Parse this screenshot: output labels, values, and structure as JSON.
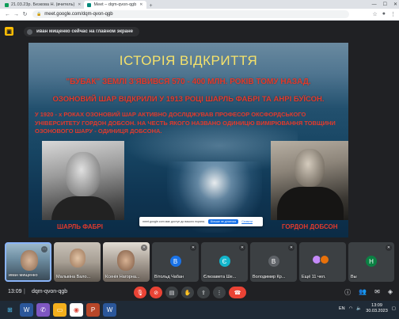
{
  "browser": {
    "tabs": [
      {
        "label": "21.03.23р. Безкова Н. (вчитель)",
        "fav_color": "#0f9d58",
        "active": false
      },
      {
        "label": "Meet – dqm-qvon-qgb",
        "fav_color": "#00897b",
        "active": true
      }
    ],
    "new_tab": "+",
    "window_controls": [
      "—",
      "☐",
      "✕"
    ],
    "url": "meet.google.com/dqm-qvon-qgb"
  },
  "meet": {
    "presenting_text": "иван мищенко сейчас на главном экране",
    "slide": {
      "title": "ІСТОРІЯ ВІДКРИТТЯ",
      "line1": "\"БУБАК\" ЗЕМЛІ З'ЯВИВСЯ 570 - 400 МЛН. РОКІВ ТОМУ НАЗАД.",
      "line2": "ОЗОНОВИЙ ШАР ВІДКРИЛИ У 1913 РОЦІ ШАРЛЬ ФАБРІ ТА АНРІ БУЇСОН.",
      "paragraph": "У 1920 - х РОКАХ ОЗОНОВИЙ ШАР АКТИВНО ДОСЛІДЖУВАВ ПРОФЕСОР ОКСФОРДСЬКОГО УНІВЕРСИТЕТУ ГОРДОН ДОБСОН. НА ЧЕСТЬ ЯКОГО НАЗВАНО ОДИНИЦЮ ВИМІРЮВАННЯ ТОВЩИНИ ОЗОНОВОГО ШАРУ - ОДИНИЦЯ ДОБСОНА.",
      "caption_left": "ШАРЛЬ ФАБРІ",
      "caption_right": "ГОРДОН ДОБСОН"
    },
    "share_bar": {
      "text": "meet.google.com має доступ до вашого екрана.",
      "stop_label": "Більше не ділитися",
      "hide_label": "Сховати"
    },
    "participants": [
      {
        "name": "иван мищенко",
        "type": "video",
        "muted": false
      },
      {
        "name": "Мальвіна Вало...",
        "type": "video",
        "muted": false
      },
      {
        "name": "Ксенія Нагорна...",
        "type": "video",
        "muted": true
      },
      {
        "name": "Вітольд Чабан",
        "type": "avatar",
        "initial": "В",
        "color": "#1a73e8",
        "muted": true
      },
      {
        "name": "Єлизавета Ше...",
        "type": "avatar",
        "initial": "Є",
        "color": "#12b5cb",
        "muted": true
      },
      {
        "name": "Володимир Кр...",
        "type": "avatar",
        "initial": "В",
        "color": "#5f6368",
        "muted": true
      },
      {
        "name": "Ещё 11 чел.",
        "type": "more",
        "muted": false
      },
      {
        "name": "Вы",
        "type": "avatar",
        "initial": "Н",
        "color": "#0b8043",
        "muted": true
      }
    ]
  },
  "bottom": {
    "time": "13:09",
    "separator": "|",
    "meeting_code": "dqm-qvon-qgb"
  },
  "taskbar": {
    "lang": "EN",
    "time": "13:09",
    "date": "30.03.2023"
  }
}
